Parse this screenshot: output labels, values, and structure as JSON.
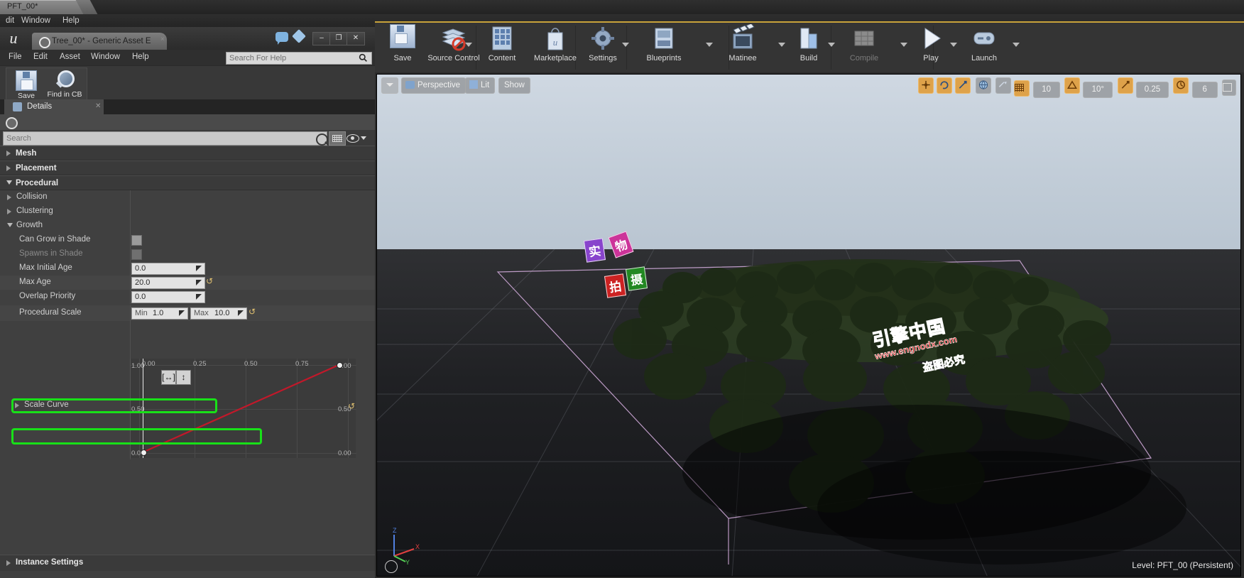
{
  "outer_window": {
    "tab_title": "PFT_00*",
    "menu": [
      "dit",
      "Window",
      "Help"
    ]
  },
  "asset_editor": {
    "tab_title": "Tree_00* - Generic Asset E",
    "tab_close": "×",
    "menu": [
      "File",
      "Edit",
      "Asset",
      "Window",
      "Help"
    ],
    "help_search_placeholder": "Search For Help",
    "window_buttons": [
      "–",
      "❐",
      "✕"
    ],
    "toolbar": [
      {
        "label": "Save",
        "icon": "floppy-disk-icon"
      },
      {
        "label": "Find in CB",
        "icon": "magnifier-icon"
      }
    ],
    "details_tab": "Details",
    "search_placeholder": "Search",
    "search_value": ""
  },
  "details": {
    "categories": [
      {
        "name": "Mesh",
        "expanded": false
      },
      {
        "name": "Placement",
        "expanded": false
      },
      {
        "name": "Procedural",
        "expanded": true
      }
    ],
    "subgroups": [
      {
        "name": "Collision",
        "expanded": false
      },
      {
        "name": "Clustering",
        "expanded": false
      },
      {
        "name": "Growth",
        "expanded": true
      }
    ],
    "properties": [
      {
        "name": "Can Grow in Shade",
        "type": "checkbox",
        "checked": false,
        "disabled": false
      },
      {
        "name": "Spawns in Shade",
        "type": "checkbox",
        "checked": false,
        "disabled": true
      },
      {
        "name": "Max Initial Age",
        "type": "number",
        "value": "0.0",
        "reverted": false,
        "highlighted": false
      },
      {
        "name": "Max Age",
        "type": "number",
        "value": "20.0",
        "reverted": true,
        "highlighted": true
      },
      {
        "name": "Overlap Priority",
        "type": "number",
        "value": "0.0",
        "reverted": false,
        "highlighted": false
      },
      {
        "name": "Procedural Scale",
        "type": "minmax",
        "min_label": "Min",
        "min_value": "1.0",
        "max_label": "Max",
        "max_value": "10.0",
        "reverted": true,
        "highlighted": true
      },
      {
        "name": "Scale Curve",
        "type": "curve",
        "expanded": false
      }
    ],
    "footer_category": "Instance Settings",
    "revert_glyph": "↺",
    "highlight_color": "#18e018"
  },
  "scale_curve": {
    "x_ticks": [
      "0.00",
      "0.25",
      "0.50",
      "0.75"
    ],
    "y_left_ticks": [
      "1.00",
      "0.50",
      "0.00"
    ],
    "y_right_ticks": [
      "1.00",
      "0.50",
      "0.00"
    ],
    "pan_button": "[↔]",
    "zoom_button": "↕",
    "curve_color": "#c2182a",
    "points": [
      {
        "x": 0.0,
        "y": 0.0
      },
      {
        "x": 1.0,
        "y": 1.0
      }
    ]
  },
  "main_toolbar": [
    {
      "label": "Save",
      "icon": "floppy-disk-icon",
      "dropdown": false,
      "disabled": false
    },
    {
      "label": "Source Control",
      "icon": "source-control-icon",
      "dropdown": true,
      "disabled": false
    },
    {
      "label": "Content",
      "icon": "content-browser-icon",
      "dropdown": false,
      "disabled": false
    },
    {
      "label": "Marketplace",
      "icon": "marketplace-bag-icon",
      "dropdown": false,
      "disabled": false
    },
    {
      "label": "Settings",
      "icon": "gear-icon",
      "dropdown": true,
      "disabled": false
    },
    {
      "label": "Blueprints",
      "icon": "blueprint-icon",
      "dropdown": true,
      "disabled": false
    },
    {
      "label": "Matinee",
      "icon": "clapperboard-icon",
      "dropdown": true,
      "disabled": false
    },
    {
      "label": "Build",
      "icon": "build-icon",
      "dropdown": true,
      "disabled": false
    },
    {
      "label": "Compile",
      "icon": "compile-icon",
      "dropdown": true,
      "disabled": true
    },
    {
      "label": "Play",
      "icon": "play-icon",
      "dropdown": true,
      "disabled": false
    },
    {
      "label": "Launch",
      "icon": "launch-icon",
      "dropdown": true,
      "disabled": false
    }
  ],
  "viewport": {
    "left_buttons": [
      {
        "label": "",
        "name": "viewport-options-dropdown",
        "icon": "chevron-down-icon"
      },
      {
        "label": "Perspective",
        "name": "camera-mode-button",
        "icon": "camera-icon"
      },
      {
        "label": "Lit",
        "name": "view-mode-button",
        "icon": "cube-icon"
      },
      {
        "label": "Show",
        "name": "show-flags-button",
        "icon": ""
      }
    ],
    "right_buttons": [
      {
        "label": "",
        "name": "translate-mode-button",
        "icon": "move-gizmo-icon",
        "active": true
      },
      {
        "label": "",
        "name": "rotate-mode-button",
        "icon": "rotate-gizmo-icon",
        "active": true
      },
      {
        "label": "",
        "name": "scale-mode-button",
        "icon": "scale-gizmo-icon",
        "active": true
      },
      {
        "label": "",
        "name": "world-space-button",
        "icon": "globe-icon",
        "active": false
      },
      {
        "label": "",
        "name": "surface-snap-button",
        "icon": "surface-snap-icon",
        "active": false
      },
      {
        "label": "",
        "name": "grid-snap-toggle",
        "icon": "grid-icon",
        "active": true
      },
      {
        "label": "10",
        "name": "grid-snap-value",
        "icon": "",
        "active": false
      },
      {
        "label": "",
        "name": "rotation-snap-toggle",
        "icon": "angle-icon",
        "active": true
      },
      {
        "label": "10°",
        "name": "rotation-snap-value",
        "icon": "",
        "active": false
      },
      {
        "label": "",
        "name": "scale-snap-toggle",
        "icon": "scale-snap-icon",
        "active": true
      },
      {
        "label": "0.25",
        "name": "scale-snap-value",
        "icon": "",
        "active": false
      },
      {
        "label": "",
        "name": "camera-speed-toggle",
        "icon": "camera-speed-icon",
        "active": true
      },
      {
        "label": "6",
        "name": "camera-speed-value",
        "icon": "",
        "active": false
      },
      {
        "label": "",
        "name": "maximize-viewport-button",
        "icon": "maximize-icon",
        "active": false
      }
    ],
    "axis_labels": {
      "x": "X",
      "y": "Y",
      "z": "Z"
    },
    "axis_colors": {
      "x": "#e04040",
      "y": "#55d055",
      "z": "#5080e0"
    },
    "status": "Level:  PFT_00 (Persistent)"
  },
  "watermark": {
    "line1": "引擎中国",
    "line2": "www.engnodx.com",
    "line3": "盗图必究",
    "badges": [
      {
        "text": "实",
        "color": "#8844cc"
      },
      {
        "text": "物",
        "color": "#cc3399"
      },
      {
        "text": "拍",
        "color": "#cc2222"
      },
      {
        "text": "摄",
        "color": "#228822"
      }
    ]
  }
}
